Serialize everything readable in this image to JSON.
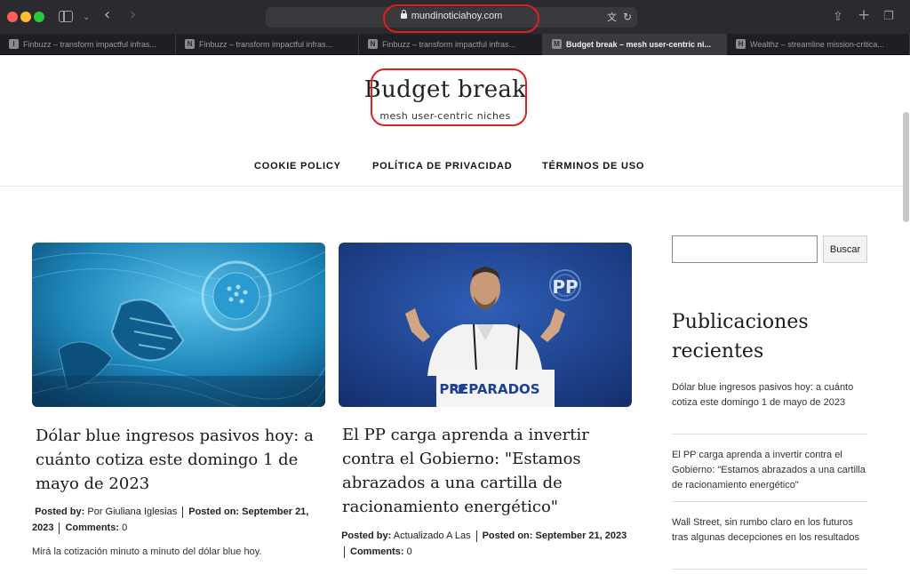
{
  "browser": {
    "url": "mundinoticiahoy.com",
    "tabs": [
      {
        "favicon": "I",
        "title": "Finbuzz – transform impactful infras..."
      },
      {
        "favicon": "N",
        "title": "Finbuzz – transform impactful infras..."
      },
      {
        "favicon": "N",
        "title": "Finbuzz – transform impactful infras..."
      },
      {
        "favicon": "M",
        "title": "Budget break – mesh user-centric ni..."
      },
      {
        "favicon": "H",
        "title": "Wealthz – streamline mission-critica..."
      }
    ],
    "active_tab": 3
  },
  "site": {
    "title": "Budget break",
    "tagline": "mesh user-centric niches"
  },
  "nav": [
    "COOKIE POLICY",
    "POLÍTICA DE PRIVACIDAD",
    "TÉRMINOS DE USO"
  ],
  "posts": [
    {
      "title": "Dólar blue ingresos pasivos hoy: a cuánto cotiza este domingo 1 de mayo de 2023",
      "posted_by_label": "Posted by:",
      "author": "Por Giuliana Iglesias",
      "posted_on_label": "Posted on:",
      "date": "September 21, 2023",
      "comments_label": "Comments:",
      "comments": "0",
      "excerpt": "Mirá la cotización minuto a minuto del dólar blue hoy."
    },
    {
      "title": "El PP carga aprenda a invertir contra el Gobierno: \"Estamos abrazados a una cartilla de racionamiento energético\"",
      "posted_by_label": "Posted by:",
      "author": "Actualizado A Las",
      "posted_on_label": "Posted on:",
      "date": "September 21, 2023",
      "comments_label": "Comments:",
      "comments": "0",
      "image_text": "PREPARADOS",
      "logo_text": "PP"
    }
  ],
  "sidebar": {
    "search_button": "Buscar",
    "recent_heading": "Publicaciones recientes",
    "recent": [
      "Dólar blue ingresos pasivos hoy: a cuánto cotiza este domingo 1 de mayo de 2023",
      "El PP carga aprenda a invertir contra el Gobierno: \"Estamos abrazados a una cartilla de racionamiento energético\"",
      "Wall Street, sin rumbo claro en los futuros tras algunas decepciones en los resultados"
    ]
  },
  "colors": {
    "highlight": "#e0201c",
    "chrome": "#2b2a2f"
  }
}
